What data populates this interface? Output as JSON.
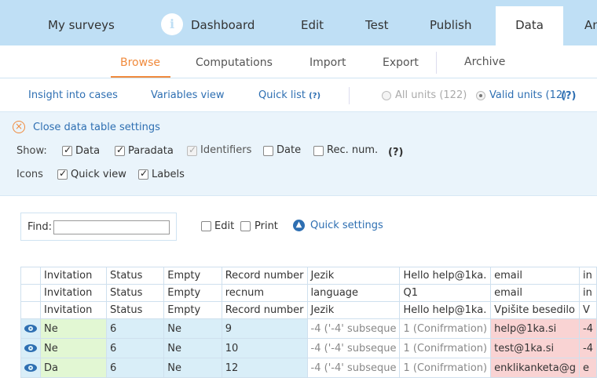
{
  "nav": {
    "tabs": [
      "My surveys",
      "Dashboard",
      "Edit",
      "Test",
      "Publish",
      "Data",
      "An"
    ],
    "info_glyph": "i",
    "active": "Data"
  },
  "subnav": {
    "tabs": [
      "Browse",
      "Computations",
      "Import",
      "Export",
      "Archive"
    ],
    "active": "Browse"
  },
  "views": {
    "insight": "Insight into cases",
    "variables": "Variables view",
    "quicklist": "Quick list",
    "help": "(?)",
    "all_units": "All units (122)",
    "valid_units": "Valid units (12)",
    "units_help": "(?)"
  },
  "settings": {
    "close_label": "Close data table settings",
    "show_label": "Show:",
    "show_options": [
      {
        "label": "Data",
        "checked": true
      },
      {
        "label": "Paradata",
        "checked": true
      },
      {
        "label": "Identifiers",
        "checked": true,
        "disabled": true
      },
      {
        "label": "Date",
        "checked": false
      },
      {
        "label": "Rec. num.",
        "checked": false
      }
    ],
    "show_help": "(?)",
    "icons_label": "Icons",
    "icon_options": [
      {
        "label": "Quick view",
        "checked": true
      },
      {
        "label": "Labels",
        "checked": true
      }
    ]
  },
  "find": {
    "label": "Find:",
    "value": "",
    "edit_label": "Edit",
    "print_label": "Print",
    "quick_settings": "Quick settings"
  },
  "table": {
    "header_rows": [
      [
        "Invitation",
        "Status",
        "Empty",
        "Record number",
        "Jezik",
        "Hello help@1ka.",
        "email",
        "in"
      ],
      [
        "Invitation",
        "Status",
        "Empty",
        "recnum",
        "language",
        "Q1",
        "email",
        "in"
      ],
      [
        "Invitation",
        "Status",
        "Empty",
        "Record number",
        "Jezik",
        "Hello help@1ka.",
        "Vpišite besedilo",
        "V"
      ]
    ],
    "rows": [
      [
        "Ne",
        "6",
        "Ne",
        "9",
        "-4 ('-4' subseque",
        "1 (Conifrmation)",
        "help@1ka.si",
        "-4"
      ],
      [
        "Ne",
        "6",
        "Ne",
        "10",
        "-4 ('-4' subseque",
        "1 (Conifrmation)",
        "test@1ka.si",
        "-4"
      ],
      [
        "Da",
        "6",
        "Ne",
        "12",
        "-4 ('-4' subseque",
        "1 (Conifrmation)",
        "enklikanketa@g",
        "e"
      ]
    ]
  },
  "colors": {
    "nav_bg": "#bfdff5",
    "accent_orange": "#f08a3c",
    "link_blue": "#2e6fb2",
    "row_blue": "#d9eef8",
    "cell_green": "#e2f7d3",
    "cell_pink": "#f9d3d3"
  }
}
